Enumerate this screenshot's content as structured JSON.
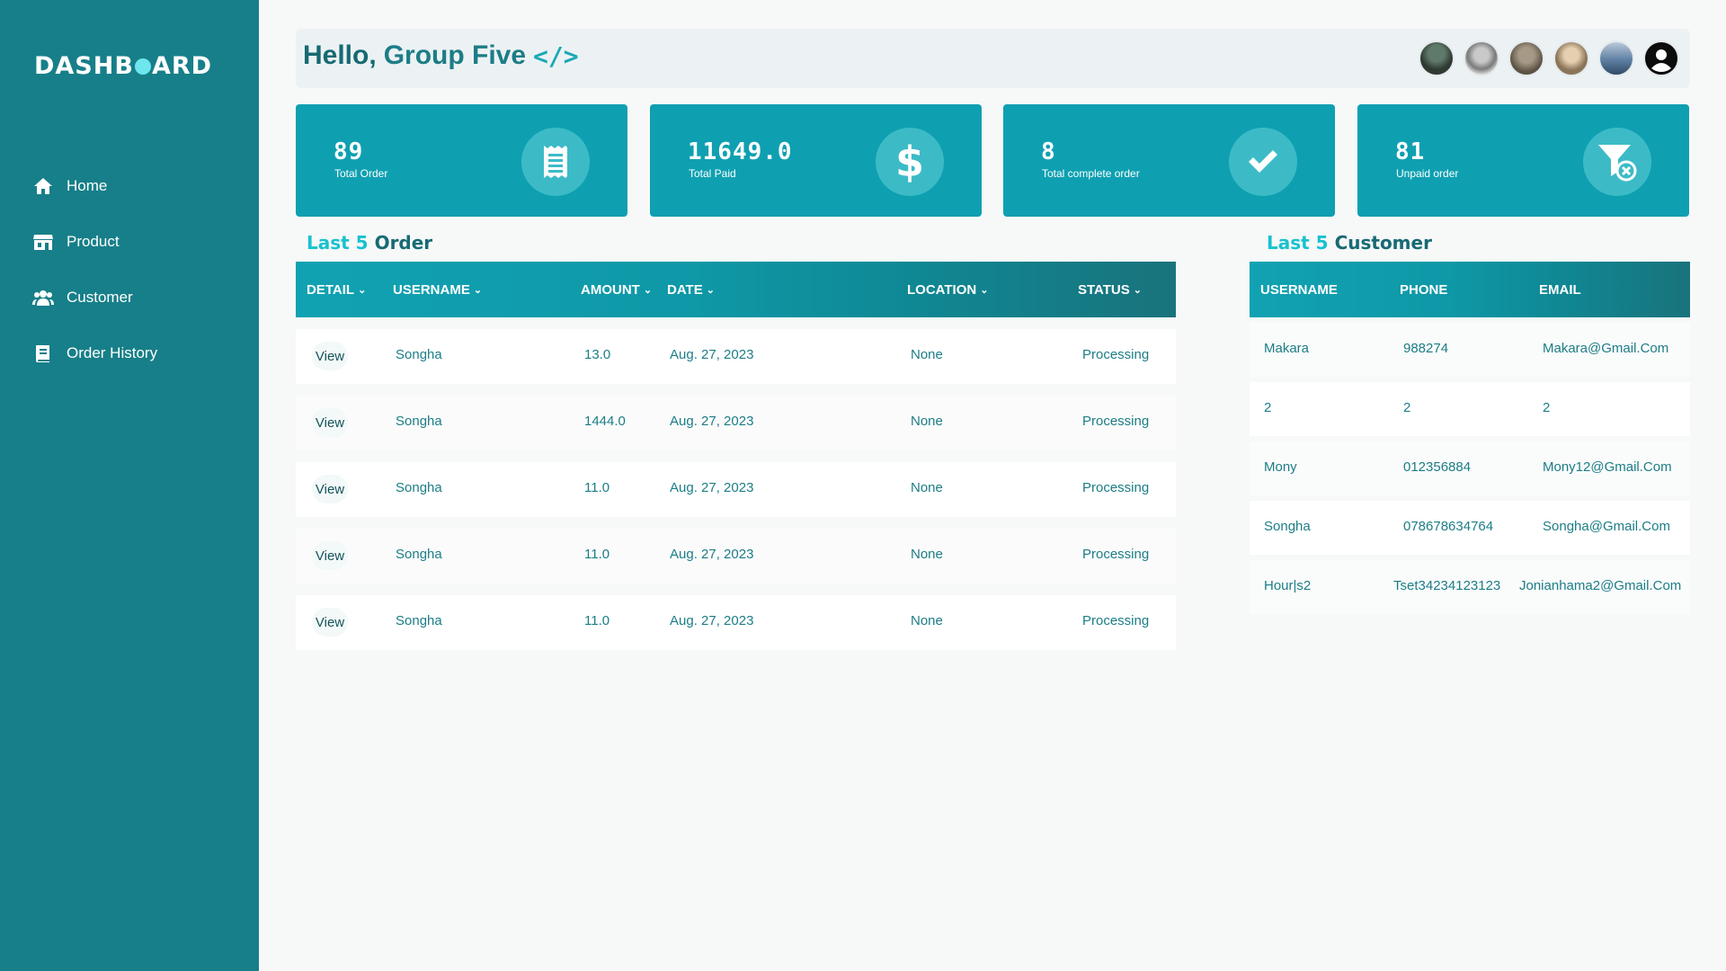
{
  "sidebar": {
    "logo_left": "DASHB",
    "logo_right": "ARD",
    "items": [
      {
        "label": "Home",
        "icon": "home-icon"
      },
      {
        "label": "Product",
        "icon": "store-icon"
      },
      {
        "label": "Customer",
        "icon": "users-icon"
      },
      {
        "label": "Order History",
        "icon": "book-icon"
      }
    ]
  },
  "header": {
    "greeting_hello": "Hello,",
    "greeting_name": "Group Five",
    "code_icon": "</>",
    "avatars": [
      "avatar-1",
      "avatar-2",
      "avatar-3",
      "avatar-4",
      "avatar-5",
      "avatar-default"
    ]
  },
  "stats": [
    {
      "value": "89",
      "label": "Total Order",
      "icon": "receipt-icon"
    },
    {
      "value": "11649.0",
      "label": "Total Paid",
      "icon": "dollar-icon"
    },
    {
      "value": "8",
      "label": "Total complete order",
      "icon": "check-icon"
    },
    {
      "value": "81",
      "label": "Unpaid order",
      "icon": "filter-x-icon"
    }
  ],
  "orders": {
    "title_accent": "Last 5",
    "title_rest": "Order",
    "columns": [
      "DETAIL",
      "USERNAME",
      "AMOUNT",
      "DATE",
      "LOCATION",
      "STATUS"
    ],
    "rows": [
      {
        "detail": "View",
        "username": "Songha",
        "amount": "13.0",
        "date": "Aug. 27, 2023",
        "location": "None",
        "status": "Processing"
      },
      {
        "detail": "View",
        "username": "Songha",
        "amount": "1444.0",
        "date": "Aug. 27, 2023",
        "location": "None",
        "status": "Processing"
      },
      {
        "detail": "View",
        "username": "Songha",
        "amount": "11.0",
        "date": "Aug. 27, 2023",
        "location": "None",
        "status": "Processing"
      },
      {
        "detail": "View",
        "username": "Songha",
        "amount": "11.0",
        "date": "Aug. 27, 2023",
        "location": "None",
        "status": "Processing"
      },
      {
        "detail": "View",
        "username": "Songha",
        "amount": "11.0",
        "date": "Aug. 27, 2023",
        "location": "None",
        "status": "Processing"
      }
    ]
  },
  "customers": {
    "title_accent": "Last 5",
    "title_rest": "Customer",
    "columns": [
      "USERNAME",
      "PHONE",
      "EMAIL"
    ],
    "rows": [
      {
        "username": "Makara",
        "phone": "988274",
        "email": "Makara@Gmail.Com"
      },
      {
        "username": "2",
        "phone": "2",
        "email": "2"
      },
      {
        "username": "Mony",
        "phone": "012356884",
        "email": "Mony12@Gmail.Com"
      },
      {
        "username": "Songha",
        "phone": "078678634764",
        "email": "Songha@Gmail.Com"
      },
      {
        "username": "Hour|s2",
        "phone": "Tset34234123123",
        "email": "Jonianhama2@Gmail.Com"
      }
    ]
  },
  "colors": {
    "sidebar": "#177f89",
    "card": "#0ea0b1",
    "accent": "#18c2cf",
    "text": "#1c7d86"
  }
}
